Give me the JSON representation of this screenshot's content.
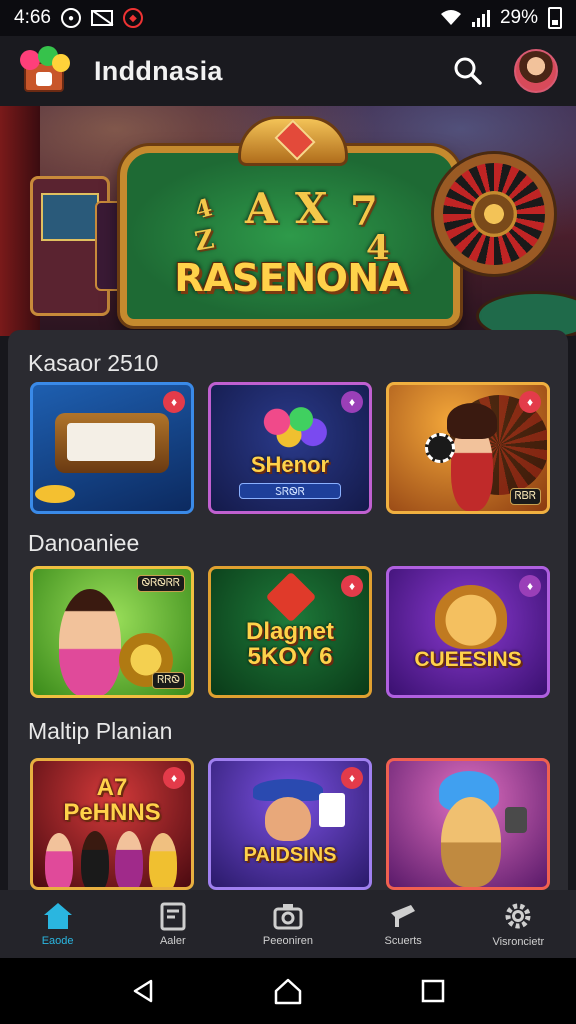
{
  "status_bar": {
    "time": "4:66",
    "battery": "29%"
  },
  "header": {
    "title": "Inddnasia"
  },
  "hero": {
    "nums": [
      "4",
      "A",
      "X",
      "7",
      "Z",
      "4"
    ],
    "title": "RASENONA"
  },
  "sections": [
    {
      "title": "Kasaor 2510",
      "cards": [
        {
          "text": "",
          "sub": "",
          "badge": "♦",
          "tag": ""
        },
        {
          "text": "SHenor",
          "sub": "ᏚᏒᏫᏒ",
          "badge": "♦",
          "tag": ""
        },
        {
          "text": "",
          "sub": "",
          "badge": "♦",
          "tag": "ᏒᏴᏒ"
        }
      ]
    },
    {
      "title": "Danoaniee",
      "cards": [
        {
          "text": "",
          "sub": "",
          "badge": "",
          "tag": "ᏫᏒᏫᏒᏒ"
        },
        {
          "text": "Dlagnet\n5KOY 6",
          "sub": "",
          "badge": "♦",
          "tag": ""
        },
        {
          "text": "CUEESINS",
          "sub": "",
          "badge": "♦",
          "tag": ""
        }
      ]
    },
    {
      "title": "Maltip Planian",
      "cards": [
        {
          "text": "A7\nPeHNNS",
          "sub": "",
          "badge": "♦",
          "tag": ""
        },
        {
          "text": "PAIDSINS",
          "sub": "",
          "badge": "♦",
          "tag": ""
        },
        {
          "text": "",
          "sub": "",
          "badge": "",
          "tag": ""
        }
      ]
    }
  ],
  "bottom_nav": [
    {
      "label": "Eaode",
      "icon": "home-icon",
      "active": true
    },
    {
      "label": "Aaler",
      "icon": "document-icon",
      "active": false
    },
    {
      "label": "Peeoniren",
      "icon": "camera-icon",
      "active": false
    },
    {
      "label": "Scuerts",
      "icon": "megaphone-icon",
      "active": false
    },
    {
      "label": "Visroncietr",
      "icon": "gear-icon",
      "active": false
    }
  ],
  "colors": {
    "accent": "#2ab6e0",
    "gold": "#ffd24a",
    "badge_red": "#e33b4a"
  }
}
